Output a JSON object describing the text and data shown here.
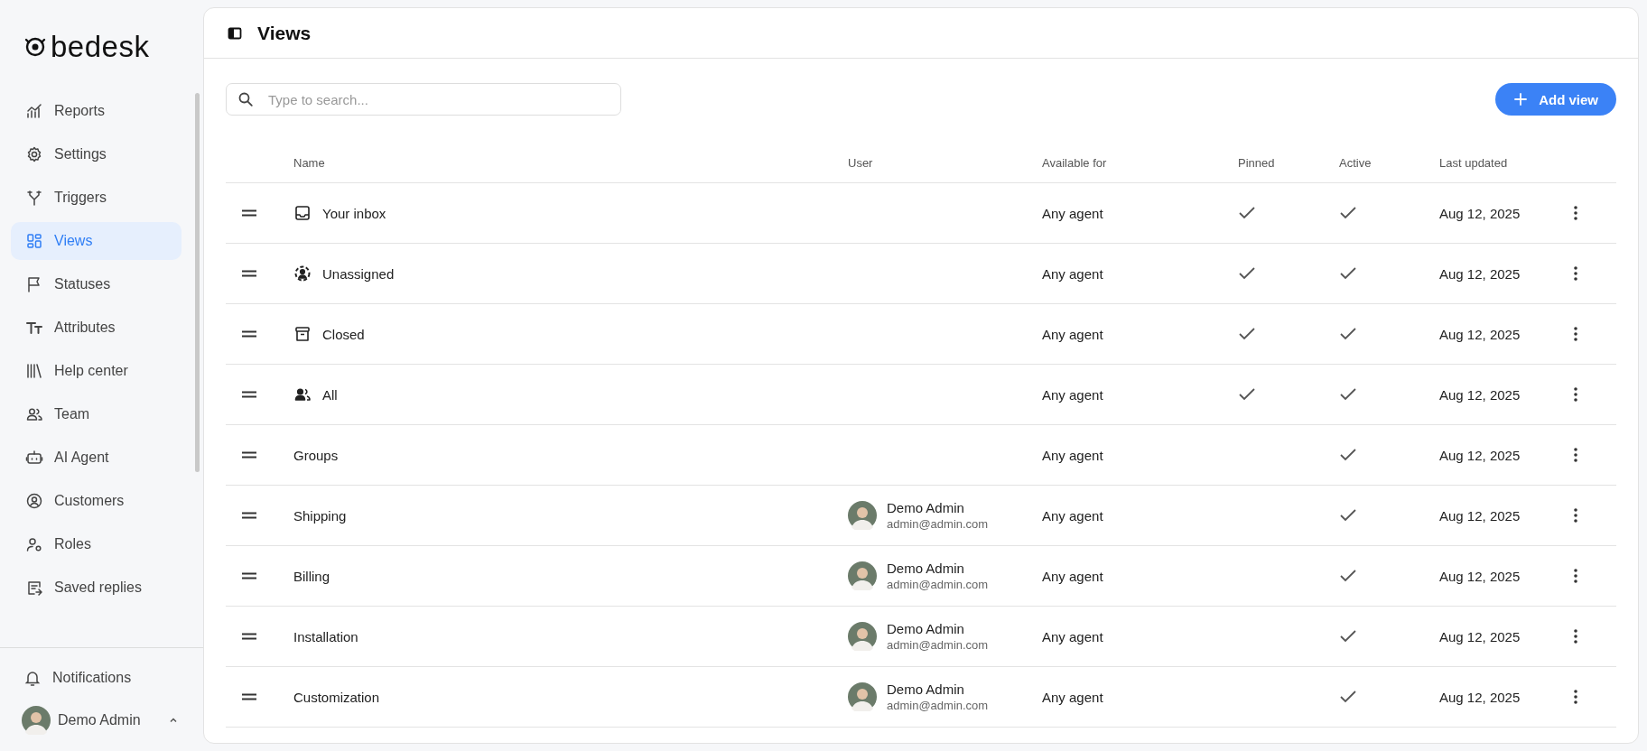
{
  "sidebar": {
    "logo": "bedesk",
    "items": [
      {
        "label": "Reports",
        "selected": false
      },
      {
        "label": "Settings",
        "selected": false
      },
      {
        "label": "Triggers",
        "selected": false
      },
      {
        "label": "Views",
        "selected": true
      },
      {
        "label": "Statuses",
        "selected": false
      },
      {
        "label": "Attributes",
        "selected": false
      },
      {
        "label": "Help center",
        "selected": false
      },
      {
        "label": "Team",
        "selected": false
      },
      {
        "label": "AI Agent",
        "selected": false
      },
      {
        "label": "Customers",
        "selected": false
      },
      {
        "label": "Roles",
        "selected": false
      },
      {
        "label": "Saved replies",
        "selected": false
      }
    ],
    "notifications": "Notifications",
    "user": "Demo Admin"
  },
  "page": {
    "title": "Views",
    "search": {
      "placeholder": "Type to search..."
    },
    "add_button": "Add view"
  },
  "table": {
    "columns": [
      "Name",
      "User",
      "Available for",
      "Pinned",
      "Active",
      "Last updated"
    ],
    "rows": [
      {
        "name": "Your inbox",
        "available": "Any agent",
        "pinned": true,
        "active": true,
        "updated": "Aug 12, 2025"
      },
      {
        "name": "Unassigned",
        "available": "Any agent",
        "pinned": true,
        "active": true,
        "updated": "Aug 12, 2025"
      },
      {
        "name": "Closed",
        "available": "Any agent",
        "pinned": true,
        "active": true,
        "updated": "Aug 12, 2025"
      },
      {
        "name": "All",
        "available": "Any agent",
        "pinned": true,
        "active": true,
        "updated": "Aug 12, 2025"
      },
      {
        "name": "Groups",
        "available": "Any agent",
        "pinned": false,
        "active": true,
        "updated": "Aug 12, 2025"
      },
      {
        "name": "Shipping",
        "user": {
          "name": "Demo Admin",
          "email": "admin@admin.com"
        },
        "available": "Any agent",
        "pinned": false,
        "active": true,
        "updated": "Aug 12, 2025"
      },
      {
        "name": "Billing",
        "user": {
          "name": "Demo Admin",
          "email": "admin@admin.com"
        },
        "available": "Any agent",
        "pinned": false,
        "active": true,
        "updated": "Aug 12, 2025"
      },
      {
        "name": "Installation",
        "user": {
          "name": "Demo Admin",
          "email": "admin@admin.com"
        },
        "available": "Any agent",
        "pinned": false,
        "active": true,
        "updated": "Aug 12, 2025"
      },
      {
        "name": "Customization",
        "user": {
          "name": "Demo Admin",
          "email": "admin@admin.com"
        },
        "available": "Any agent",
        "pinned": false,
        "active": true,
        "updated": "Aug 12, 2025"
      }
    ]
  }
}
